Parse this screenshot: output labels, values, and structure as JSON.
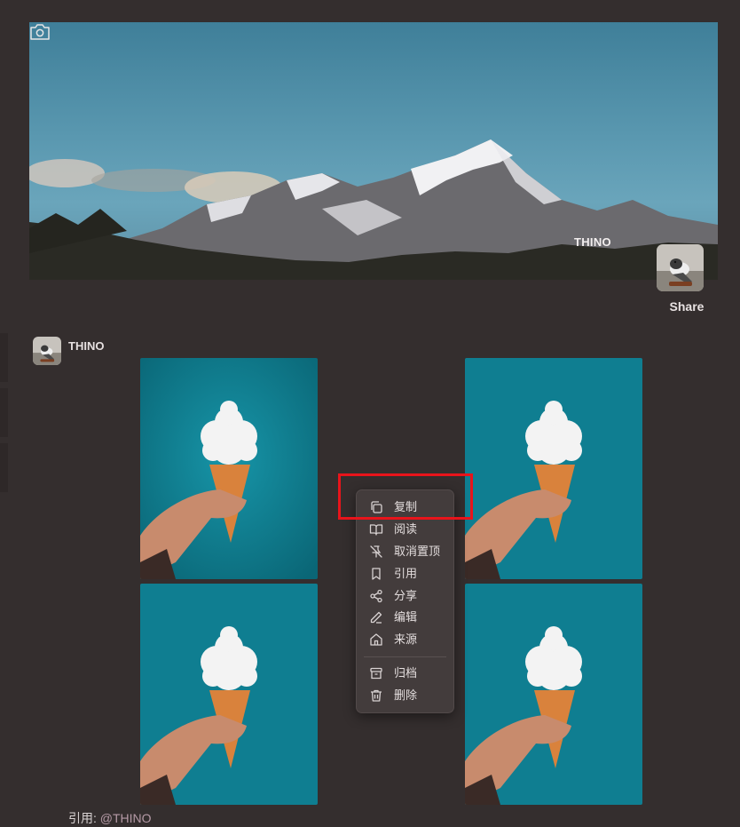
{
  "banner": {
    "username": "THINO",
    "share_label": "Share"
  },
  "memo": {
    "username": "THINO",
    "image_count": 4,
    "quote_prefix": "引用:",
    "quote_link": "@THINO"
  },
  "context_menu": {
    "items": [
      {
        "label": "复制",
        "icon": "copy-icon"
      },
      {
        "label": "阅读",
        "icon": "book-open-icon"
      },
      {
        "label": "取消置顶",
        "icon": "pin-off-icon"
      },
      {
        "label": "引用",
        "icon": "bookmark-icon"
      },
      {
        "label": "分享",
        "icon": "share-icon"
      },
      {
        "label": "编辑",
        "icon": "pencil-icon"
      },
      {
        "label": "来源",
        "icon": "home-icon"
      },
      {
        "label": "归档",
        "icon": "archive-icon"
      },
      {
        "label": "删除",
        "icon": "trash-icon"
      }
    ]
  },
  "colors": {
    "background": "#342e2e",
    "menu_background": "#433c3c",
    "highlight": "#e8141b",
    "link": "#b59aa6"
  }
}
